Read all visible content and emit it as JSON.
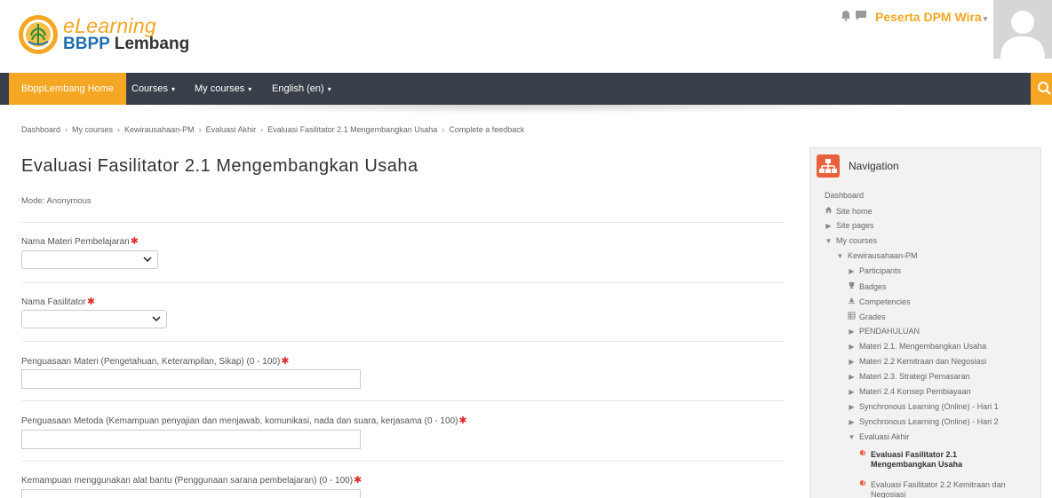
{
  "header": {
    "logo_line1": "eLearning",
    "logo_line2a": "BBPP",
    "logo_line2b": "Lembang",
    "user_name": "Peserta DPM Wira",
    "user_caret": "▾"
  },
  "navbar": {
    "home": "BbppLembang Home",
    "items": [
      {
        "label": "Courses"
      },
      {
        "label": "My courses"
      },
      {
        "label": "English (en)"
      }
    ],
    "caret": "▾"
  },
  "breadcrumb": {
    "items": [
      "Dashboard",
      "My courses",
      "Kewirausahaan-PM",
      "Evaluasi Akhir",
      "Evaluasi Fasilitator 2.1 Mengembangkan Usaha",
      "Complete a feedback"
    ],
    "sep": "›"
  },
  "main": {
    "title": "Evaluasi Fasilitator 2.1 Mengembangkan Usaha",
    "mode": "Mode: Anonymous",
    "required_mark": "✱",
    "questions": [
      {
        "label": "Nama Materi Pembelajaran",
        "type": "select",
        "value": ""
      },
      {
        "label": "Nama Fasilitator",
        "type": "select",
        "value": ""
      },
      {
        "label": "Penguasaan Materi (Pengetahuan, Keterampilan, Sikap) (0 - 100)",
        "type": "text",
        "value": ""
      },
      {
        "label": "Penguasaan Metoda (Kemampuan penyajian dan menjawab, komunikasi, nada dan suara, kerjasama (0 - 100)",
        "type": "text",
        "value": ""
      },
      {
        "label": "Kemampuan menggunakan alat bantu (Penggunaan sarana pembelajaran) (0 - 100)",
        "type": "text",
        "value": ""
      }
    ]
  },
  "navigation": {
    "title": "Navigation",
    "nodes": [
      {
        "label": "Dashboard",
        "icon": ""
      },
      {
        "label": "Site home",
        "icon": "home-icon"
      },
      {
        "label": "Site pages",
        "icon": "caret-right-icon"
      },
      {
        "label": "My courses",
        "icon": "caret-down-icon"
      },
      {
        "label": "Kewirausahaan-PM",
        "icon": "caret-down-icon"
      },
      {
        "label": "Participants",
        "icon": "caret-right-icon"
      },
      {
        "label": "Badges",
        "icon": "trophy-icon"
      },
      {
        "label": "Competencies",
        "icon": "competency-icon"
      },
      {
        "label": "Grades",
        "icon": "grades-icon"
      },
      {
        "label": "PENDAHULUAN",
        "icon": "caret-right-icon"
      },
      {
        "label": "Materi 2.1. Mengembangkan Usaha",
        "icon": "caret-right-icon"
      },
      {
        "label": "Materi 2.2 Kemitraan dan Negosiasi",
        "icon": "caret-right-icon"
      },
      {
        "label": "Materi 2.3. Strategi Pemasaran",
        "icon": "caret-right-icon"
      },
      {
        "label": "Materi 2.4 Konsep Pembiayaan",
        "icon": "caret-right-icon"
      },
      {
        "label": "Synchronous Learning (Online) - Hari 1",
        "icon": "caret-right-icon"
      },
      {
        "label": "Synchronous Learning (Online) - Hari 2",
        "icon": "caret-right-icon"
      },
      {
        "label": "Evaluasi Akhir",
        "icon": "caret-down-icon"
      },
      {
        "label": "Evaluasi Fasilitator 2.1",
        "label2": "Mengembangkan Usaha",
        "icon": "feedback-icon",
        "active": true
      },
      {
        "label": "Evaluasi Fasilitator 2.2 Kemitraan dan",
        "label2": "Negosiasi",
        "icon": "feedback-icon"
      }
    ]
  },
  "colors": {
    "accent": "#f5a623",
    "navbar": "#383f48",
    "brand_blue": "#1f6fae",
    "required": "#e02d2d",
    "block_icon": "#e8613c"
  }
}
